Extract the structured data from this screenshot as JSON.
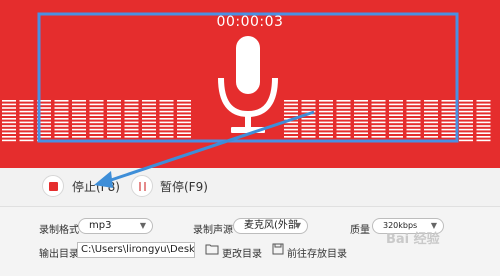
{
  "recorder": {
    "timer": "00:00:03",
    "stop_label": "停止(F8)",
    "pause_label": "暂停(F9)"
  },
  "settings": {
    "format_label": "录制格式",
    "format_value": "mp3",
    "source_label": "录制声源",
    "source_value": "麦克风(外部",
    "quality_label": "质量",
    "quality_value": "320kbps",
    "output_label": "输出目录",
    "output_path": "C:\\Users\\lirongyu\\Desktop",
    "change_dir_label": "更改目录",
    "open_dir_label": "前往存放目录"
  },
  "watermark": "Bai 经验",
  "colors": {
    "background": "#e52d2d",
    "highlight": "#4a90e2",
    "arrow": "#3e8ed8"
  },
  "icons": [
    "microphone-icon",
    "stop-icon",
    "pause-icon",
    "folder-icon",
    "save-icon"
  ]
}
